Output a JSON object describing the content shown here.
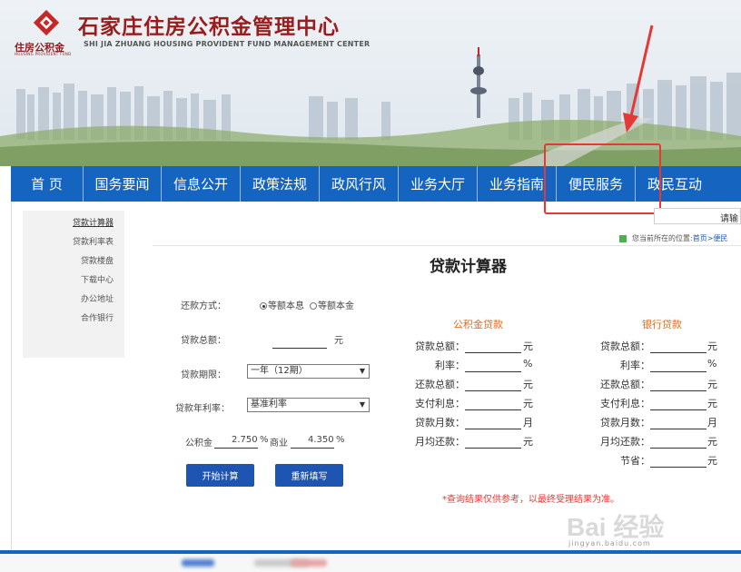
{
  "header": {
    "title": "石家庄住房公积金管理中心",
    "title_en": "SHI JIA ZHUANG HOUSING PROVIDENT FUND MANAGEMENT CENTER",
    "logo_text": "住房公积金",
    "logo_text_en": "HOUSING PROVIDENT FUND",
    "brand_color": "#9a1c1c"
  },
  "nav": {
    "color": "#1565c0",
    "items": [
      {
        "label": "首 页"
      },
      {
        "label": "国务要闻"
      },
      {
        "label": "信息公开"
      },
      {
        "label": "政策法规"
      },
      {
        "label": "政风行风"
      },
      {
        "label": "业务大厅"
      },
      {
        "label": "业务指南"
      },
      {
        "label": "便民服务",
        "highlighted": true
      },
      {
        "label": "政民互动"
      }
    ]
  },
  "sidebar": {
    "items": [
      {
        "label": "贷款计算器",
        "active": true
      },
      {
        "label": "贷款利率表"
      },
      {
        "label": "贷款楼盘"
      },
      {
        "label": "下载中心"
      },
      {
        "label": "办公地址"
      },
      {
        "label": "合作银行"
      }
    ]
  },
  "search": {
    "placeholder": "请输"
  },
  "breadcrumb": {
    "prefix": "您当前所在的位置:",
    "home": "首页",
    "separator": ">",
    "current": "便民"
  },
  "calculator": {
    "title": "贷款计算器",
    "repay_method_label": "还款方式：",
    "repay_options": [
      {
        "label": "等额本息",
        "checked": true
      },
      {
        "label": "等额本金",
        "checked": false
      }
    ],
    "loan_amount_label": "贷款总额：",
    "loan_amount_unit": "元",
    "loan_term_label": "贷款期限：",
    "loan_term_value": "一年（12期）",
    "rate_label": "贷款年利率：",
    "rate_value": "基准利率",
    "fund_label": "公积金",
    "fund_rate": "2.750",
    "fund_unit": "%",
    "commercial_label": "商业",
    "commercial_rate": "4.350",
    "commercial_unit": "%",
    "calc_button": "开始计算",
    "reset_button": "重新填写"
  },
  "results": {
    "fund_title": "公积金贷款",
    "bank_title": "银行贷款",
    "fund_rows": [
      {
        "label": "贷款总额：",
        "unit": "元"
      },
      {
        "label": "利率：",
        "unit": "%"
      },
      {
        "label": "还款总额：",
        "unit": "元"
      },
      {
        "label": "支付利息：",
        "unit": "元"
      },
      {
        "label": "贷款月数：",
        "unit": "月"
      },
      {
        "label": "月均还款：",
        "unit": "元"
      }
    ],
    "bank_rows": [
      {
        "label": "贷款总额：",
        "unit": "元"
      },
      {
        "label": "利率：",
        "unit": "%"
      },
      {
        "label": "还款总额：",
        "unit": "元"
      },
      {
        "label": "支付利息：",
        "unit": "元"
      },
      {
        "label": "贷款月数：",
        "unit": "月"
      },
      {
        "label": "月均还款：",
        "unit": "元"
      },
      {
        "label": "节省：",
        "unit": "元"
      }
    ],
    "disclaimer": "*查询结果仅供参考，以最终受理结果为准。"
  },
  "watermark": {
    "text": "Bai 经验",
    "url": "jingyan.baidu.com"
  },
  "annotation_color": "#e53935"
}
